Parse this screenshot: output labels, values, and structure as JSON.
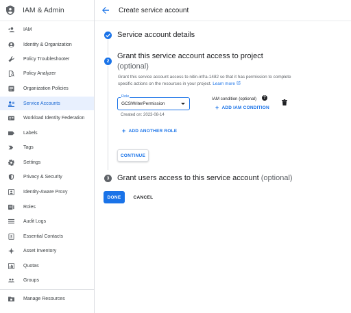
{
  "sidebar": {
    "title": "IAM & Admin",
    "items": [
      {
        "label": "IAM",
        "icon": "person-add-icon"
      },
      {
        "label": "Identity & Organization",
        "icon": "account-circle-icon"
      },
      {
        "label": "Policy Troubleshooter",
        "icon": "wrench-icon"
      },
      {
        "label": "Policy Analyzer",
        "icon": "document-search-icon"
      },
      {
        "label": "Organization Policies",
        "icon": "list-doc-icon"
      },
      {
        "label": "Service Accounts",
        "icon": "service-account-icon"
      },
      {
        "label": "Workload Identity Federation",
        "icon": "id-card-icon"
      },
      {
        "label": "Labels",
        "icon": "label-icon"
      },
      {
        "label": "Tags",
        "icon": "tag-chevron-icon"
      },
      {
        "label": "Settings",
        "icon": "gear-icon"
      },
      {
        "label": "Privacy & Security",
        "icon": "shield-icon"
      },
      {
        "label": "Identity-Aware Proxy",
        "icon": "proxy-icon"
      },
      {
        "label": "Roles",
        "icon": "roles-icon"
      },
      {
        "label": "Audit Logs",
        "icon": "list-icon"
      },
      {
        "label": "Essential Contacts",
        "icon": "contacts-icon"
      },
      {
        "label": "Asset Inventory",
        "icon": "asset-icon"
      },
      {
        "label": "Quotas",
        "icon": "quotas-icon"
      },
      {
        "label": "Groups",
        "icon": "groups-icon"
      }
    ],
    "footer": {
      "label": "Manage Resources",
      "icon": "folder-icon"
    },
    "active_index": 5
  },
  "header": {
    "title": "Create service account"
  },
  "steps": {
    "step1": {
      "title": "Service account details"
    },
    "step2": {
      "number": "2",
      "title": "Grant this service account access to project",
      "optional": "(optional)",
      "description": "Grant this service account access to nitin-infra-1482 so that it has permission to complete specific actions on the resources in your project.",
      "learn_more": "Learn more",
      "role_label": "Role",
      "role_value": "GCSWriterPermission",
      "created_on": "Created on: 2023-08-14",
      "iam_condition_label": "IAM condition (optional)",
      "add_iam_condition": "ADD IAM CONDITION",
      "add_another_role": "ADD ANOTHER ROLE",
      "continue": "CONTINUE"
    },
    "step3": {
      "number": "3",
      "title": "Grant users access to this service account",
      "optional": "(optional)"
    }
  },
  "actions": {
    "done": "DONE",
    "cancel": "CANCEL"
  },
  "colors": {
    "accent": "#1a73e8",
    "active_bg": "#e8f0fe",
    "step_complete": "#1a73e8",
    "step_inactive": "#5f6368"
  }
}
